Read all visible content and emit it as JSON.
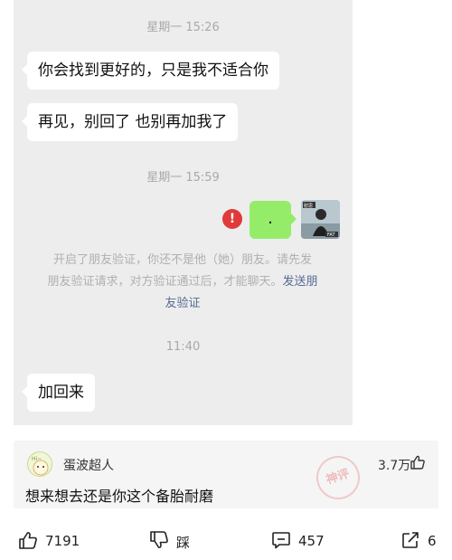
{
  "chat": {
    "time1": "星期一 15:26",
    "msg1": "你会找到更好的，只是我不适合你",
    "msg2": "再见，别回了 也别再加我了",
    "time2": "星期一 15:59",
    "my_msg": ".",
    "alert_symbol": "!",
    "system_line1": "开启了朋友验证，你还不是他（她）朋友。请先发",
    "system_line2_prefix": "朋友验证请求，对方验证通过后，才能聊天。",
    "system_link_part1": "发送朋",
    "system_link_part2": "友验证",
    "time3": "11:40",
    "msg3": "加回来",
    "avatar_badge_top": "慰思",
    "avatar_badge_bottom": "FAT"
  },
  "comment": {
    "username": "蛋波超人",
    "avatar_text": "Hi~",
    "likes": "3.7万",
    "text": "想来想去还是你这个备胎耐磨",
    "stamp": "神评"
  },
  "actions": {
    "like_count": "7191",
    "dislike_label": "踩",
    "comment_count": "457",
    "share_count": "6"
  },
  "colors": {
    "chat_bg": "#ededed",
    "my_bubble": "#95ec69",
    "link": "#576b95",
    "alert": "#e03a3a"
  }
}
